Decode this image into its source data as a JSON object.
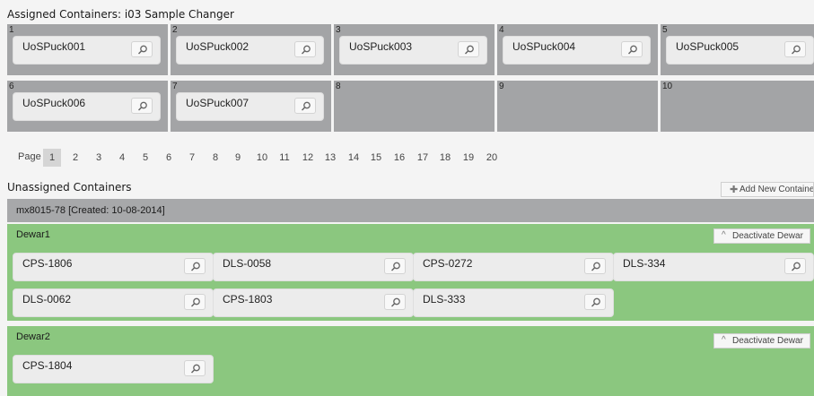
{
  "assigned": {
    "heading": "Assigned Containers: i03 Sample Changer",
    "positions": [
      {
        "num": "1",
        "container": "UoSPuck001"
      },
      {
        "num": "2",
        "container": "UoSPuck002"
      },
      {
        "num": "3",
        "container": "UoSPuck003"
      },
      {
        "num": "4",
        "container": "UoSPuck004"
      },
      {
        "num": "5",
        "container": "UoSPuck005"
      },
      {
        "num": "6",
        "container": "UoSPuck006"
      },
      {
        "num": "7",
        "container": "UoSPuck007"
      },
      {
        "num": "8",
        "container": ""
      },
      {
        "num": "9",
        "container": ""
      },
      {
        "num": "10",
        "container": ""
      }
    ]
  },
  "pagination": {
    "label": "Page",
    "pages": [
      "1",
      "2",
      "3",
      "4",
      "5",
      "6",
      "7",
      "8",
      "9",
      "10",
      "11",
      "12",
      "13",
      "14",
      "15",
      "16",
      "17",
      "18",
      "19",
      "20"
    ],
    "current": "1"
  },
  "unassigned": {
    "heading": "Unassigned Containers",
    "add_button": "Add New Container",
    "shipment": "mx8015-78 [Created: 10-08-2014]",
    "dewars": [
      {
        "name": "Dewar1",
        "deactivate": "Deactivate Dewar",
        "containers": [
          "CPS-1806",
          "DLS-0058",
          "CPS-0272",
          "DLS-334",
          "DLS-0062",
          "CPS-1803",
          "DLS-333"
        ]
      },
      {
        "name": "Dewar2",
        "deactivate": "Deactivate Dewar",
        "containers": [
          "CPS-1804"
        ]
      }
    ]
  },
  "colors": {
    "dewar_green": "#8bc77f",
    "position_gray": "#a3a4a6",
    "card_bg": "#ececec"
  },
  "icons": {
    "view": "search-icon",
    "add": "plus-icon",
    "deactivate": "caret-up-icon"
  }
}
